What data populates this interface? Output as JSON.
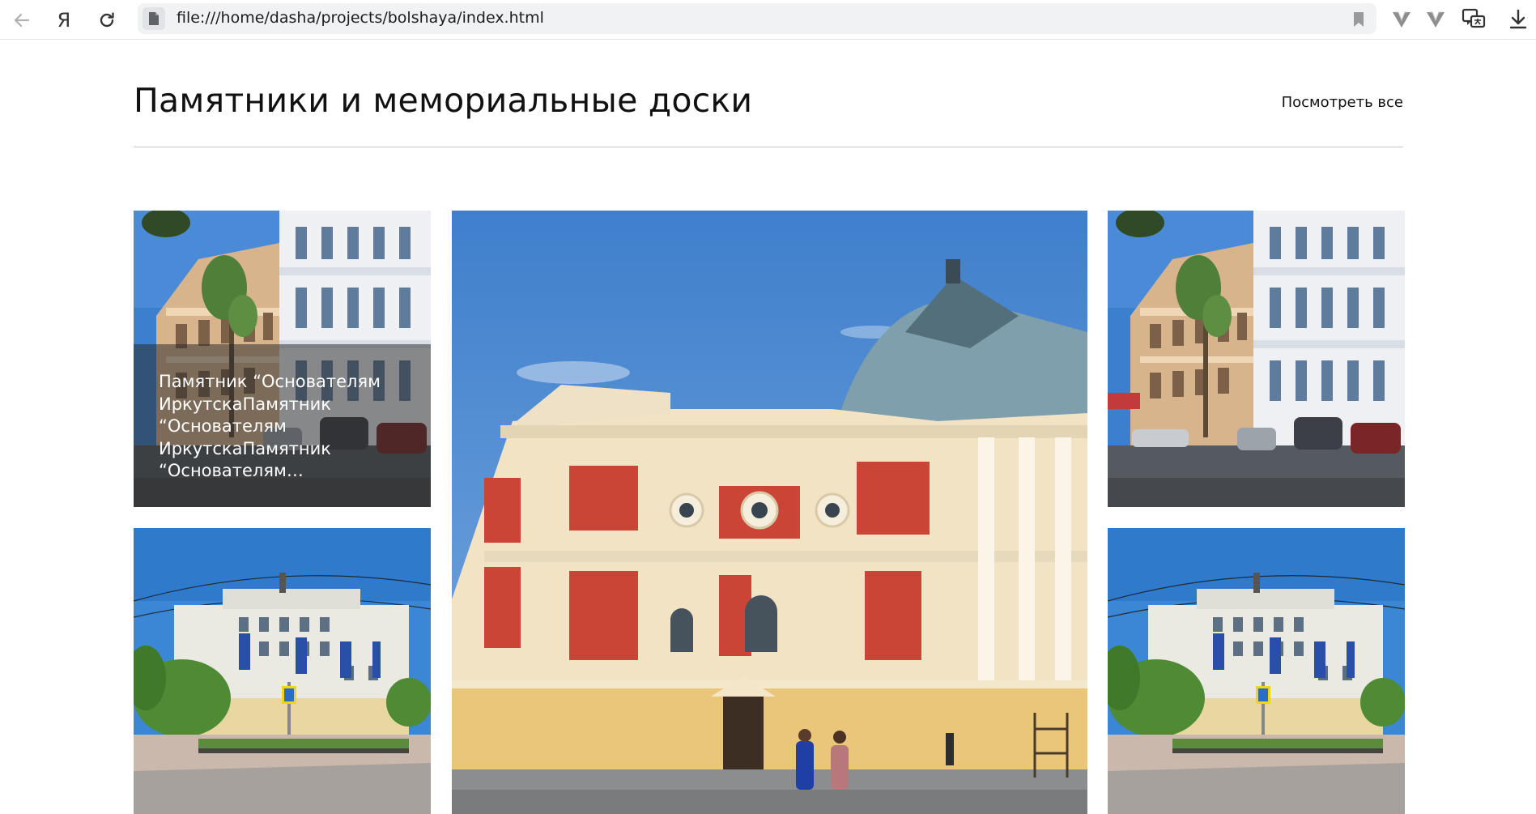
{
  "browser": {
    "url": "file:///home/dasha/projects/bolshaya/index.html",
    "buttons": {
      "back": "arrow-left-icon",
      "yandex": "Я",
      "reload": "reload-icon",
      "bookmark": "bookmark-icon",
      "extension1": "vpn-v-icon",
      "extension2": "vpn-v-icon",
      "translate": "translate-chat-icon",
      "downloads": "download-icon"
    }
  },
  "section": {
    "title": "Памятники и мемориальные доски",
    "view_all": "Посмотреть все"
  },
  "gallery": {
    "tile1": {
      "image": "street-buildings-photo",
      "caption": "Памятник “Основателям ИркутскаПамятник “Основателям ИркутскаПамятник “Основателям…"
    },
    "tile2": {
      "image": "theatre-building-photo"
    },
    "tile3": {
      "image": "street-buildings-photo"
    },
    "tile4": {
      "image": "university-building-photo"
    },
    "tile5": {
      "image": "university-building-photo"
    }
  },
  "colors": {
    "accent_text": "#111111",
    "divider": "#c9c9c9",
    "caption_overlay": "rgba(40,40,40,0.52)"
  }
}
